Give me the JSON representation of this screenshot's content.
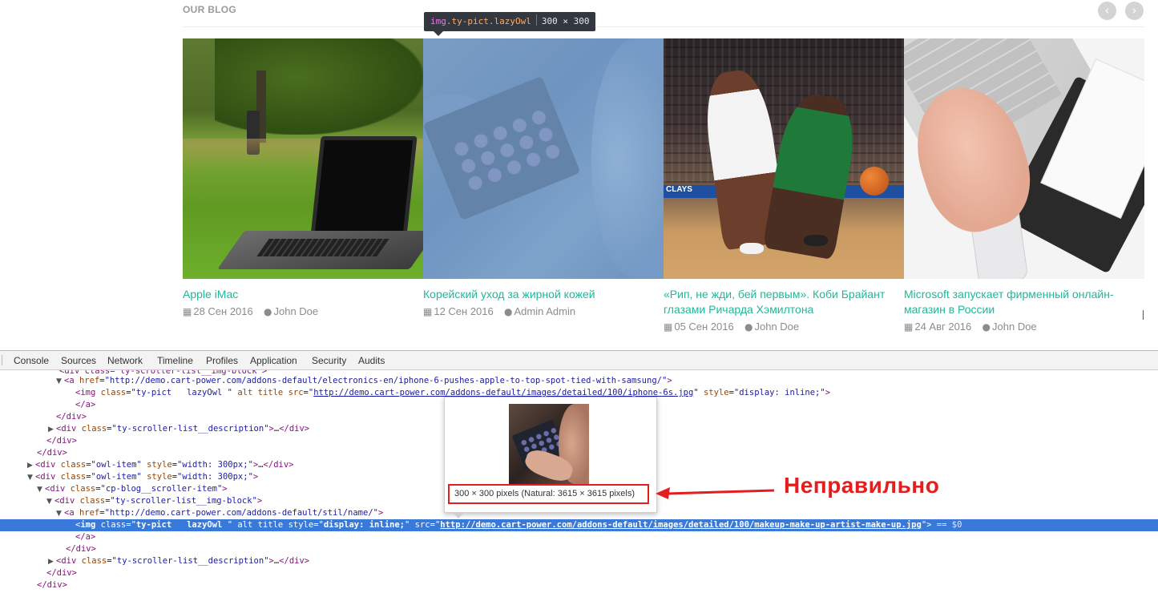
{
  "blog": {
    "title": "OUR BLOG",
    "nav": {
      "prev": "‹",
      "next": "›"
    },
    "posts": [
      {
        "title": "Apple iMac",
        "date": "28 Сен 2016",
        "author": "John Doe"
      },
      {
        "title": "Корейский уход за жирной кожей",
        "date": "12 Сен 2016",
        "author": "Admin Admin"
      },
      {
        "title": "«Рип, не жди, бей первым». Коби Брайант глазами Ричарда Хэмилтона",
        "date": "05 Сен 2016",
        "author": "John Doe"
      },
      {
        "title": "Microsoft запускает фирменный онлайн-магазин в России",
        "date": "24 Авг 2016",
        "author": "John Doe"
      }
    ],
    "icons": {
      "date": "calendar-icon",
      "author": "user-icon"
    },
    "banner_text": "CLAYS"
  },
  "element_tooltip": {
    "tag": "img",
    "classes": ".ty-pict.lazyOwl",
    "size": "300 × 300"
  },
  "devtools": {
    "tabs": [
      "Console",
      "Sources",
      "Network",
      "Timeline",
      "Profiles",
      "Application",
      "Security",
      "Audits"
    ],
    "dom_lines": {
      "l0": "<div class=\"ty-scroller-list__img-block\">",
      "l1_href": "http://demo.cart-power.com/addons-default/electronics-en/iphone-6-pushes-apple-to-top-spot-tied-with-samsung/",
      "l2_class": "ty-pict   lazyOwl ",
      "l2_src": "http://demo.cart-power.com/addons-default/images/detailed/100/iphone-6s.jpg",
      "l2_style": "display: inline;",
      "desc_class": "ty-scroller-list__description",
      "owl_item_class": "owl-item",
      "owl_item_style": "width: 300px;",
      "blog_item_class": "cp-blog__scroller-item",
      "img_block_class": "ty-scroller-list__img-block",
      "l13_href": "http://demo.cart-power.com/addons-default/stil/name/",
      "l14_class": "ty-pict   lazyOwl ",
      "l14_style": "display: inline;",
      "l14_src": "http://demo.cart-power.com/addons-default/images/detailed/100/makeup-make-up-artist-make-up.jpg",
      "l14_suffix": " == $0"
    }
  },
  "image_preview": {
    "dimensions": "300 × 300 pixels (Natural: 3615 × 3615 pixels)"
  },
  "annotation": {
    "text": "Неправильно",
    "color": "#e41e1e"
  },
  "colors": {
    "link": "#1fb89a",
    "meta": "#8c8c8c",
    "selection": "#3879d9",
    "annotation_red": "#e41e1e"
  }
}
